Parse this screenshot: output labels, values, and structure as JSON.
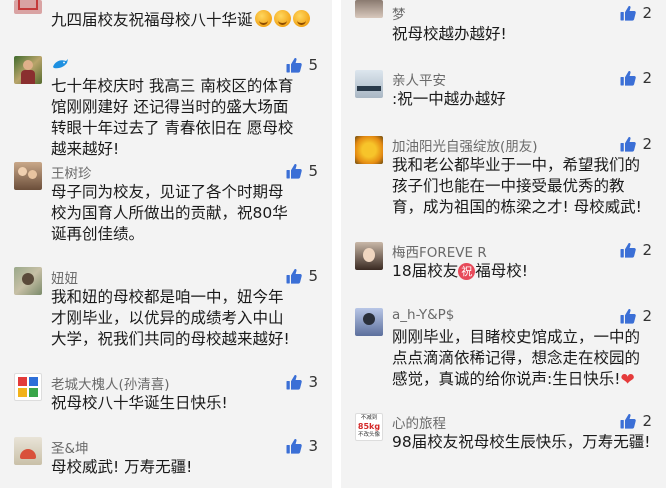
{
  "left": {
    "top_text": "九四届校友祝福母校八十华诞",
    "comments": [
      {
        "name": "",
        "likes": "5",
        "text": "七十年校庆时 我高三 南校区的体育馆刚刚建好 还记得当时的盛大场面 转眼十年过去了 青春依旧在 愿母校越来越好!"
      },
      {
        "name": "王树珍",
        "likes": "5",
        "text": "母子同为校友，见证了各个时期母校为国育人所做出的贡献，祝80华诞再创佳绩。"
      },
      {
        "name": "妞妞",
        "likes": "5",
        "text": "我和妞的母校都是咱一中，妞今年才刚毕业，以优异的成绩考入中山大学，祝我们共同的母校越来越好!"
      },
      {
        "name": "老城大槐人(孙清喜)",
        "likes": "3",
        "text": "祝母校八十华诞生日快乐!"
      },
      {
        "name": "圣&坤",
        "likes": "3",
        "text": "母校威武! 万寿无疆!"
      }
    ]
  },
  "right": {
    "comments": [
      {
        "name": "梦",
        "likes": "2",
        "text": "祝母校越办越好!"
      },
      {
        "name": "亲人平安",
        "likes": "2",
        "text": ":祝一中越办越好"
      },
      {
        "name": "加油阳光自强绽放(朋友)",
        "likes": "2",
        "text": "我和老公都毕业于一中，希望我们的孩子们也能在一中接受最优秀的教育，成为祖国的栋梁之才! 母校威武!"
      },
      {
        "name": "梅西FOREVE R",
        "likes": "2",
        "text_a": "18届校友",
        "text_b": "福母校!",
        "zhu": "祝"
      },
      {
        "name": "a_h-Y&P$",
        "likes": "2",
        "text": "刚刚毕业，目睹校史馆成立，一中的点点滴滴依稀记得，想念走在校园的感觉，真诚的给你说声:生日快乐!"
      },
      {
        "name": "心的旅程",
        "likes": "2",
        "text": "98届校友祝母校生辰快乐，万寿无疆!",
        "avatar_text": [
          "不减到",
          "85kg",
          "不改头像"
        ]
      }
    ]
  },
  "colors": {
    "like_blue": "#3b6fd6",
    "name_gray": "#6a6a6a",
    "text_black": "#1a1a1a",
    "panel_bg": "#f3f3f3"
  }
}
